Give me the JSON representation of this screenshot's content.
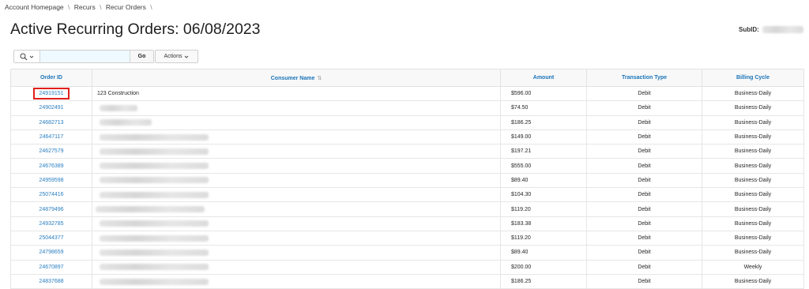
{
  "breadcrumb": {
    "items": [
      "Account Homepage",
      "Recurs",
      "Recur Orders"
    ],
    "separator": "\\"
  },
  "page": {
    "title": "Active Recurring Orders: 06/08/2023",
    "subid_label": "SubID:"
  },
  "toolbar": {
    "search_placeholder": "",
    "search_icon": "magnifier-icon",
    "go_label": "Go",
    "actions_label": "Actions"
  },
  "table": {
    "columns": [
      "Order ID",
      "Consumer Name",
      "Amount",
      "Transaction Type",
      "Billing Cycle"
    ],
    "rows": [
      {
        "order_id": "24919151",
        "consumer_name": "123 Construction",
        "amount": "$596.00",
        "type": "Debit",
        "cycle": "Business-Daily",
        "highlighted": true
      },
      {
        "order_id": "24902491",
        "consumer_name": "",
        "amount": "$74.50",
        "type": "Debit",
        "cycle": "Business-Daily"
      },
      {
        "order_id": "24682713",
        "consumer_name": "",
        "amount": "$186.25",
        "type": "Debit",
        "cycle": "Business-Daily"
      },
      {
        "order_id": "24647117",
        "consumer_name": "",
        "amount": "$149.00",
        "type": "Debit",
        "cycle": "Business-Daily"
      },
      {
        "order_id": "24627579",
        "consumer_name": "",
        "amount": "$197.21",
        "type": "Debit",
        "cycle": "Business-Daily"
      },
      {
        "order_id": "24676389",
        "consumer_name": "",
        "amount": "$555.00",
        "type": "Debit",
        "cycle": "Business-Daily"
      },
      {
        "order_id": "24959598",
        "consumer_name": "",
        "amount": "$89.40",
        "type": "Debit",
        "cycle": "Business-Daily"
      },
      {
        "order_id": "25074416",
        "consumer_name": "",
        "amount": "$104.30",
        "type": "Debit",
        "cycle": "Business-Daily"
      },
      {
        "order_id": "24879496",
        "consumer_name": "",
        "amount": "$119.20",
        "type": "Debit",
        "cycle": "Business-Daily"
      },
      {
        "order_id": "24932785",
        "consumer_name": "",
        "amount": "$183.38",
        "type": "Debit",
        "cycle": "Business-Daily"
      },
      {
        "order_id": "25044377",
        "consumer_name": "",
        "amount": "$119.20",
        "type": "Debit",
        "cycle": "Business-Daily"
      },
      {
        "order_id": "24798659",
        "consumer_name": "",
        "amount": "$89.40",
        "type": "Debit",
        "cycle": "Business-Daily"
      },
      {
        "order_id": "24670897",
        "consumer_name": "",
        "amount": "$200.00",
        "type": "Debit",
        "cycle": "Weekly"
      },
      {
        "order_id": "24837688",
        "consumer_name": "",
        "amount": "$186.25",
        "type": "Debit",
        "cycle": "Business-Daily"
      }
    ]
  },
  "colors": {
    "link": "#2a7fc1",
    "header_text": "#1a74b8",
    "highlight_box": "#e0201b",
    "search_bg": "#eefaff"
  },
  "icons": {
    "sort": "sort-ascending-icon",
    "dropdown": "chevron-down-icon"
  }
}
